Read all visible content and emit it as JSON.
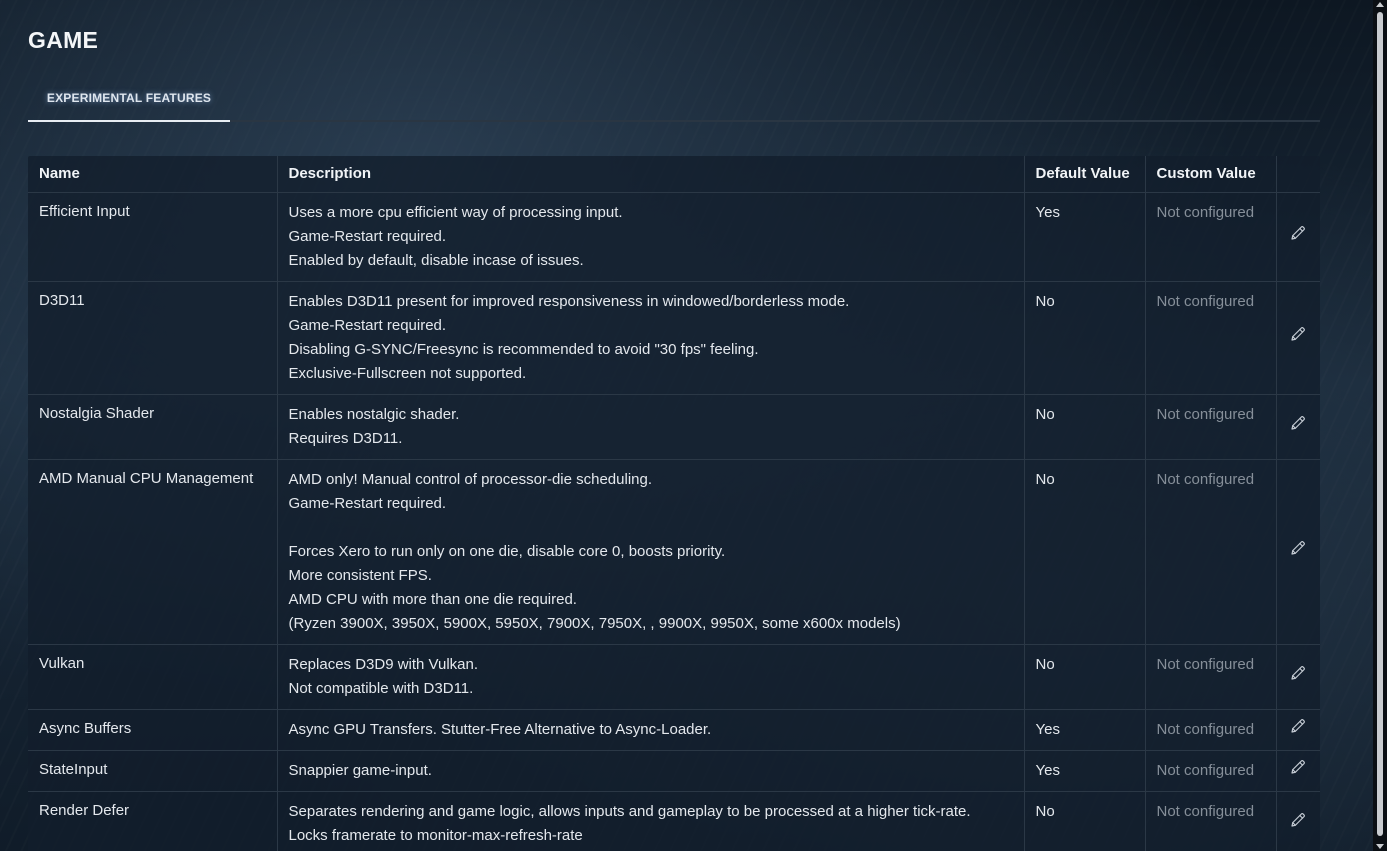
{
  "page": {
    "title": "GAME"
  },
  "tabs": [
    {
      "label": "EXPERIMENTAL FEATURES",
      "active": true
    }
  ],
  "table": {
    "headers": {
      "name": "Name",
      "description": "Description",
      "default_value": "Default Value",
      "custom_value": "Custom Value"
    },
    "rows": [
      {
        "name": "Efficient Input",
        "description": [
          "Uses a more cpu efficient way of processing input.",
          "Game-Restart required.",
          "Enabled by default, disable incase of issues."
        ],
        "default_value": "Yes",
        "custom_value": "Not configured"
      },
      {
        "name": "D3D11",
        "description": [
          "Enables D3D11 present for improved responsiveness in windowed/borderless mode.",
          "Game-Restart required.",
          "Disabling G-SYNC/Freesync is recommended to avoid \"30 fps\" feeling.",
          "Exclusive-Fullscreen not supported."
        ],
        "default_value": "No",
        "custom_value": "Not configured"
      },
      {
        "name": "Nostalgia Shader",
        "description": [
          "Enables nostalgic shader.",
          "Requires D3D11."
        ],
        "default_value": "No",
        "custom_value": "Not configured"
      },
      {
        "name": "AMD Manual CPU Management",
        "description": [
          "AMD only! Manual control of processor-die scheduling.",
          "Game-Restart required.",
          "",
          "Forces Xero to run only on one die, disable core 0, boosts priority.",
          "More consistent FPS.",
          "AMD CPU with more than one die required.",
          "(Ryzen 3900X, 3950X, 5900X, 5950X, 7900X, 7950X, , 9900X, 9950X, some x600x models)"
        ],
        "default_value": "No",
        "custom_value": "Not configured"
      },
      {
        "name": "Vulkan",
        "description": [
          "Replaces D3D9 with Vulkan.",
          "Not compatible with D3D11."
        ],
        "default_value": "No",
        "custom_value": "Not configured"
      },
      {
        "name": "Async Buffers",
        "description": [
          "Async GPU Transfers. Stutter-Free Alternative to Async-Loader."
        ],
        "default_value": "Yes",
        "custom_value": "Not configured"
      },
      {
        "name": "StateInput",
        "description": [
          "Snappier game-input."
        ],
        "default_value": "Yes",
        "custom_value": "Not configured"
      },
      {
        "name": "Render Defer",
        "description": [
          "Separates rendering and game logic, allows inputs and gameplay to be processed at a higher tick-rate.",
          "Locks framerate to monitor-max-refresh-rate"
        ],
        "default_value": "No",
        "custom_value": "Not configured"
      }
    ]
  },
  "icons": {
    "edit": "pencil-icon"
  },
  "colors": {
    "custom_value_text": "#868f99",
    "accent_underline": "#e8edf3"
  }
}
